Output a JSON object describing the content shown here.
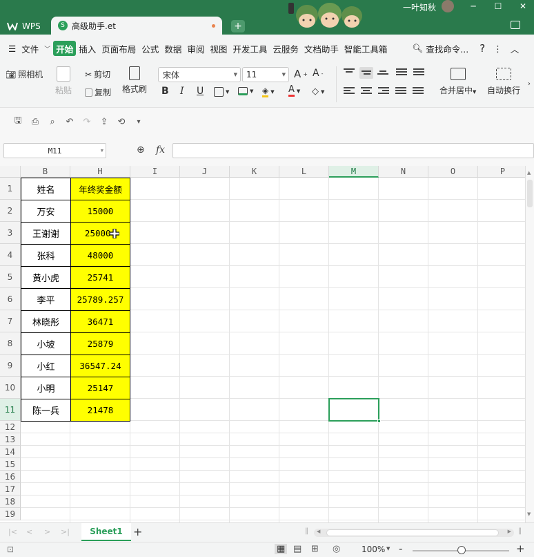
{
  "titlebar": {
    "wps_label": "WPS",
    "doc_tab_title": "高级助手.et",
    "new_tab": "+",
    "user_name": "一叶知秋",
    "colors": {
      "bar": "#2a7a4c",
      "accent": "#2b9f5a"
    }
  },
  "menu": {
    "file": "文件",
    "items": [
      "开始",
      "插入",
      "页面布局",
      "公式",
      "数据",
      "审阅",
      "视图",
      "开发工具",
      "云服务",
      "文档助手",
      "智能工具箱"
    ],
    "search": "查找命令..."
  },
  "ribbon": {
    "camera": "照相机",
    "paste": "粘贴",
    "cut": "剪切",
    "copy": "复制",
    "format_painter": "格式刷",
    "font_name": "宋体",
    "font_size": "11",
    "bold": "B",
    "italic": "I",
    "underline": "U",
    "font_color_letter": "A",
    "merge_center": "合并居中",
    "wrap_text": "自动换行"
  },
  "formula_bar": {
    "cell_ref": "M11",
    "fx": "fx",
    "value": ""
  },
  "grid": {
    "columns": [
      "B",
      "H",
      "I",
      "J",
      "K",
      "L",
      "M",
      "N",
      "O",
      "P"
    ],
    "selected_column": "M",
    "rows": [
      "1",
      "2",
      "3",
      "4",
      "5",
      "6",
      "7",
      "8",
      "9",
      "10",
      "11",
      "12",
      "13",
      "14",
      "15",
      "16",
      "17",
      "18",
      "19"
    ],
    "selected_row": "11",
    "names": [
      "姓名",
      "万安",
      "王谢谢",
      "张科",
      "黄小虎",
      "李平",
      "林晓彤",
      "小坡",
      "小红",
      "小明",
      "陈一兵"
    ],
    "amounts": [
      "年终奖金额",
      "15000",
      "25000.",
      "48000",
      "25741",
      "25789.257",
      "36471",
      "25879",
      "36547.24",
      "25147",
      "21478"
    ]
  },
  "sheets": {
    "active": "Sheet1",
    "add": "+"
  },
  "status": {
    "zoom": "100%",
    "minus": "-",
    "plus": "+"
  }
}
